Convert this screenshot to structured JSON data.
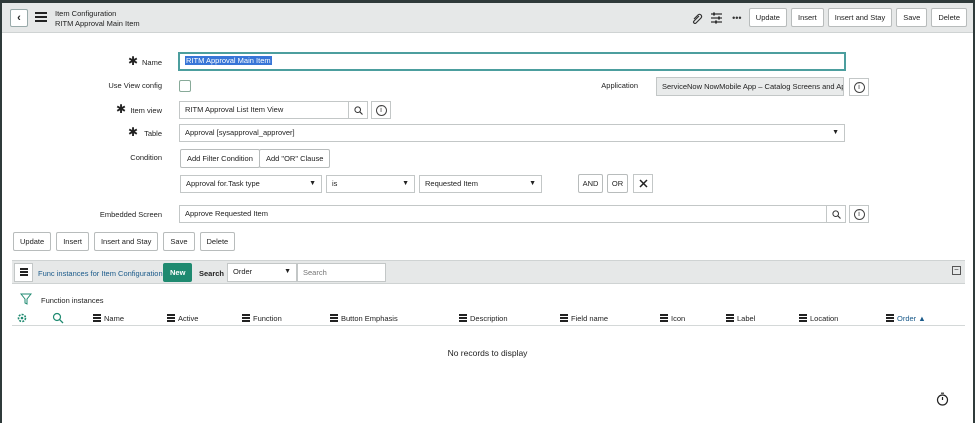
{
  "header": {
    "title": "Item Configuration",
    "subtitle": "RITM Approval Main Item",
    "buttons": [
      "Update",
      "Insert",
      "Insert and Stay",
      "Save",
      "Delete"
    ]
  },
  "form": {
    "name_label": "Name",
    "name_value": "RITM Approval Main Item",
    "use_view_config_label": "Use View config",
    "application_label": "Application",
    "application_value": "ServiceNow NowMobile App – Catalog Screens and App",
    "item_view_label": "Item view",
    "item_view_value": "RITM Approval List Item View",
    "table_label": "Table",
    "table_value": "Approval [sysapproval_approver]",
    "condition_label": "Condition",
    "add_filter_label": "Add Filter Condition",
    "add_or_label": "Add \"OR\" Clause",
    "cond_field": "Approval for.Task type",
    "cond_operator": "is",
    "cond_value": "Requested Item",
    "and_label": "AND",
    "or_label": "OR",
    "embedded_label": "Embedded Screen",
    "embedded_value": "Approve Requested Item"
  },
  "bottom_buttons": [
    "Update",
    "Insert",
    "Insert and Stay",
    "Save",
    "Delete"
  ],
  "related_list": {
    "title": "Func instances for Item Configuration",
    "new_label": "New",
    "search_label": "Search",
    "search_field": "Order",
    "search_placeholder": "Search",
    "breadcrumb": "Function instances",
    "columns": [
      "Name",
      "Active",
      "Function",
      "Button Emphasis",
      "Description",
      "Field name",
      "Icon",
      "Label",
      "Location",
      "Order ▲"
    ],
    "empty_text": "No records to display"
  },
  "colors": {
    "accent": "#1f8a70",
    "header_bg": "#e6e8e8",
    "link": "#1a5a8a"
  }
}
